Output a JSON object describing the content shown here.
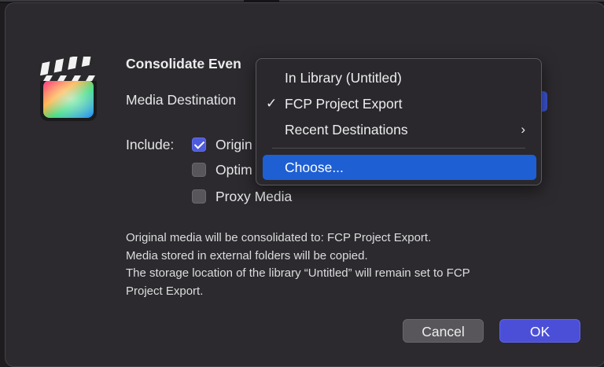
{
  "dialog": {
    "title": "Consolidate Even",
    "destination_label": "Media Destination",
    "include_label": "Include:",
    "checkboxes": [
      {
        "label": "Origin",
        "checked": true
      },
      {
        "label": "Optim",
        "checked": false
      },
      {
        "label": "Proxy Media",
        "checked": false
      }
    ],
    "info_lines": [
      "Original media will be consolidated to: FCP Project Export.",
      "Media stored in external folders will be copied.",
      "The storage location of the library “Untitled” will remain set to FCP",
      "Project Export."
    ],
    "cancel_label": "Cancel",
    "ok_label": "OK"
  },
  "menu": {
    "items": [
      {
        "label": "In Library (Untitled)"
      },
      {
        "label": "FCP Project Export",
        "checkmark": "✓"
      },
      {
        "label": "Recent Destinations",
        "chevron": "›"
      },
      {
        "label": "Choose..."
      }
    ]
  },
  "icons": {
    "app_icon": "final-cut-pro-clapperboard-icon"
  },
  "colors": {
    "accent": "#4b4fd8",
    "menu_highlight": "#1e5fd3",
    "dialog_bg": "#2c2a2e"
  }
}
